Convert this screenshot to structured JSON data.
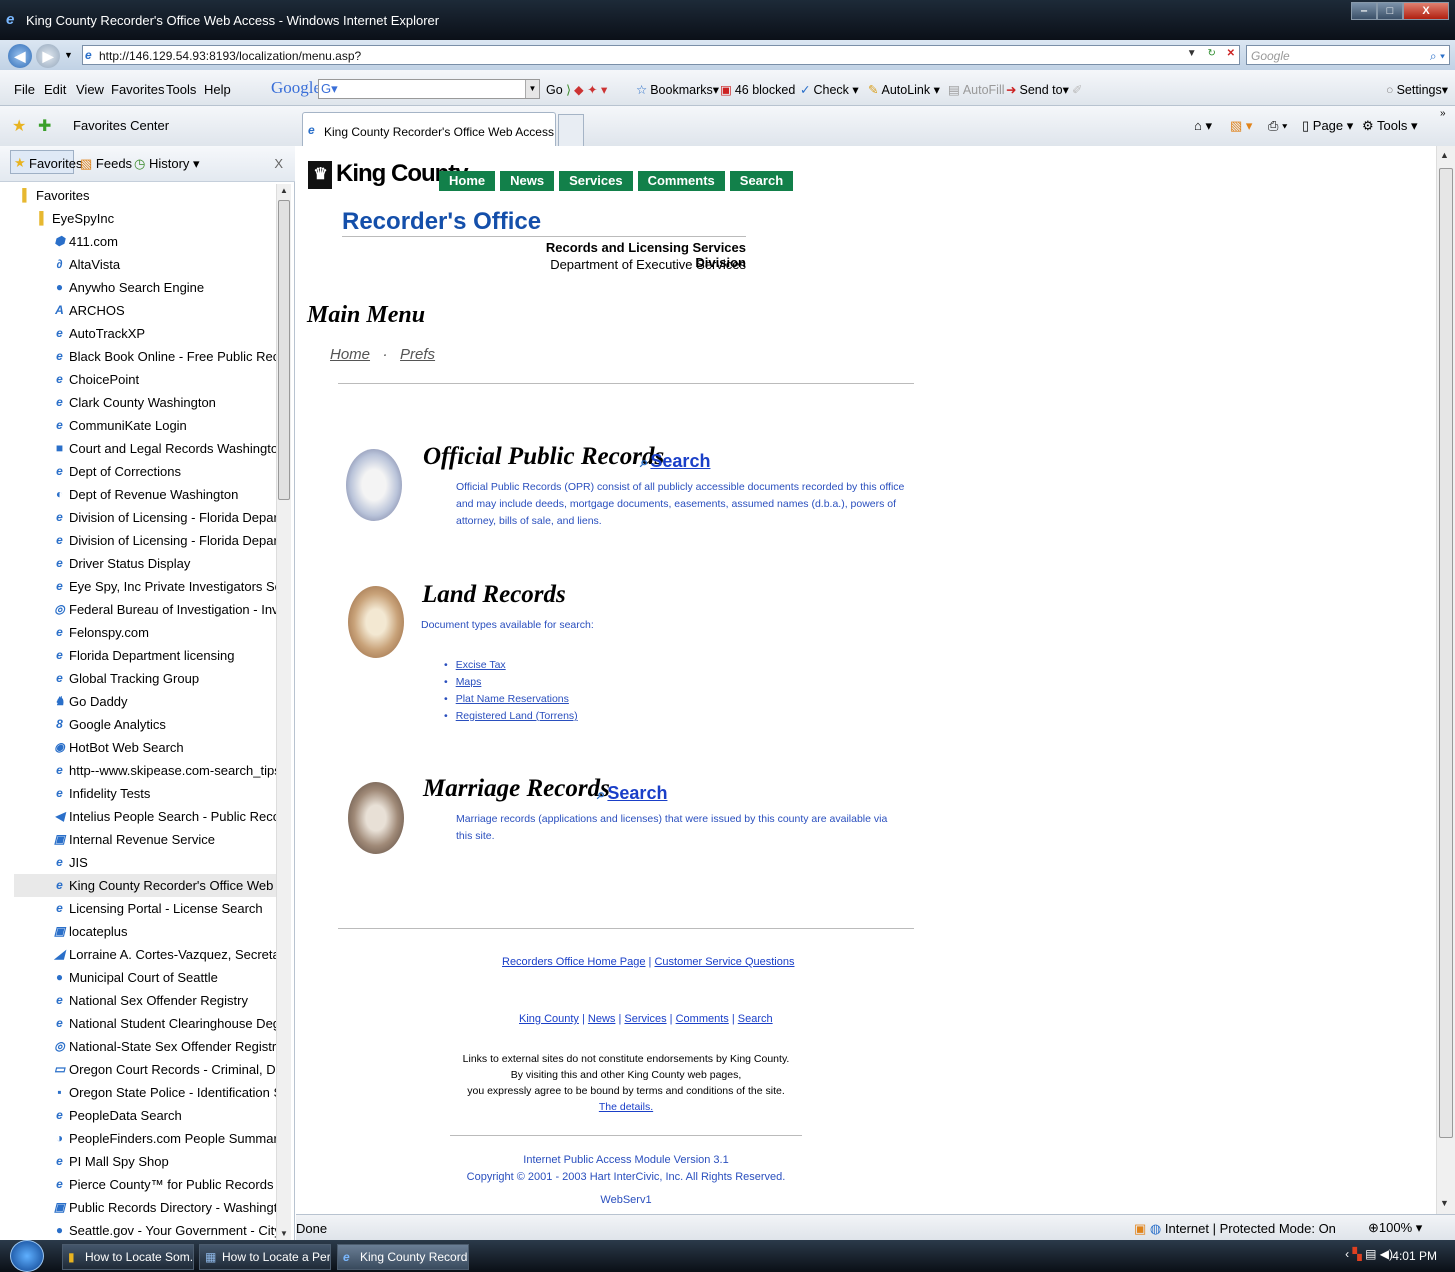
{
  "window": {
    "title": "King County Recorder's Office Web Access - Windows Internet Explorer"
  },
  "address": {
    "url": "http://146.129.54.93:8193/localization/menu.asp?",
    "search_placeholder": "Google"
  },
  "menu": [
    "File",
    "Edit",
    "View",
    "Favorites",
    "Tools",
    "Help"
  ],
  "google_toolbar": {
    "logo": "Google",
    "search_value": "G▾",
    "go": "Go",
    "bookmarks": "Bookmarks▾",
    "blocked": "46 blocked",
    "check": "Check ▾",
    "autolink": "AutoLink ▾",
    "autofill": "AutoFill",
    "sendto": "Send to▾",
    "settings": "Settings▾"
  },
  "favbar": {
    "favorites_center": "Favorites Center"
  },
  "tab": {
    "label": "King County Recorder's Office Web Access"
  },
  "commandbar": {
    "page": "Page ▾",
    "tools": "Tools ▾"
  },
  "sidebar": {
    "tabs": {
      "favorites": "Favorites",
      "feeds": "Feeds",
      "history": "History  ▾"
    },
    "close": "X",
    "root": "Favorites",
    "folder": "EyeSpyInc",
    "items": [
      {
        "label": "411.com",
        "icon": "⬢"
      },
      {
        "label": "AltaVista",
        "icon": "∂"
      },
      {
        "label": "Anywho Search Engine",
        "icon": "●"
      },
      {
        "label": "ARCHOS",
        "icon": "A"
      },
      {
        "label": "AutoTrackXP",
        "icon": "e"
      },
      {
        "label": "Black Book Online - Free Public Record Sea...",
        "icon": "e"
      },
      {
        "label": "ChoicePoint",
        "icon": "e"
      },
      {
        "label": "Clark County Washington",
        "icon": "e"
      },
      {
        "label": "CommuniKate Login",
        "icon": "e"
      },
      {
        "label": "Court and Legal Records Washington",
        "icon": "■"
      },
      {
        "label": "Dept of Corrections",
        "icon": "e"
      },
      {
        "label": "Dept of Revenue Washington",
        "icon": "◐"
      },
      {
        "label": "Division of Licensing - Florida Department ...",
        "icon": "e"
      },
      {
        "label": "Division of Licensing - Florida Department ...",
        "icon": "e"
      },
      {
        "label": "Driver Status Display",
        "icon": "e"
      },
      {
        "label": "Eye Spy, Inc Private Investigators Seattle",
        "icon": "e"
      },
      {
        "label": "Federal Bureau of Investigation - Investigat...",
        "icon": "◎"
      },
      {
        "label": "Felonspy.com",
        "icon": "e"
      },
      {
        "label": "Florida Department licensing",
        "icon": "e"
      },
      {
        "label": "Global Tracking Group",
        "icon": "e"
      },
      {
        "label": "Go Daddy",
        "icon": "♞"
      },
      {
        "label": "Google Analytics",
        "icon": "8"
      },
      {
        "label": "HotBot Web Search",
        "icon": "◉"
      },
      {
        "label": "http--www.skipease.com-search_tips-free_...",
        "icon": "e"
      },
      {
        "label": "Infidelity Tests",
        "icon": "e"
      },
      {
        "label": "Intelius People Search - Public Records, Ba...",
        "icon": "◀"
      },
      {
        "label": "Internal Revenue Service",
        "icon": "▣"
      },
      {
        "label": "JIS",
        "icon": "e"
      },
      {
        "label": "King County Recorder's Office Web Access",
        "icon": "e",
        "selected": true
      },
      {
        "label": "Licensing Portal - License Search",
        "icon": "e"
      },
      {
        "label": "locateplus",
        "icon": "▣"
      },
      {
        "label": "Lorraine A. Cortes-Vazquez, Secretary of St...",
        "icon": "◢"
      },
      {
        "label": "Municipal Court of Seattle",
        "icon": "●"
      },
      {
        "label": "National Sex Offender Registry",
        "icon": "e"
      },
      {
        "label": "National Student Clearinghouse Degree Ve...",
        "icon": "e"
      },
      {
        "label": "National-State Sex Offender Registry",
        "icon": "◎"
      },
      {
        "label": "Oregon Court Records - Criminal, Divorce, ...",
        "icon": "▭"
      },
      {
        "label": "Oregon State Police - Identification Service...",
        "icon": "▪"
      },
      {
        "label": "PeopleData Search",
        "icon": "e"
      },
      {
        "label": "PeopleFinders.com  People Summary",
        "icon": "◑"
      },
      {
        "label": "PI Mall Spy Shop",
        "icon": "e"
      },
      {
        "label": "Pierce County™ for Public Records",
        "icon": "e"
      },
      {
        "label": "Public Records Directory - Washington",
        "icon": "▣"
      },
      {
        "label": "Seattle.gov - Your Government - City Servi...",
        "icon": "●"
      }
    ]
  },
  "page": {
    "logo": "King County",
    "nav": [
      "Home",
      "News",
      "Services",
      "Comments",
      "Search"
    ],
    "office_title": "Recorder's Office",
    "division": "Records and Licensing Services Division",
    "department": "Department of Executive Services",
    "main_menu": "Main Menu",
    "crumb_home": "Home",
    "crumb_sep": "·",
    "crumb_prefs": "Prefs",
    "search_label": "Search",
    "opr": {
      "title": "Official Public Records",
      "desc_1": "Official Public Records (OPR) consist of all publicly accessible documents recorded by this office",
      "desc_2": "and may include deeds, mortgage documents, easements, assumed names (d.b.a.), powers of",
      "desc_3": "attorney, bills of sale, and liens."
    },
    "land": {
      "title": "Land Records",
      "desc": "Document types available for search:",
      "links": [
        "Excise Tax",
        "Maps",
        "Plat Name Reservations",
        "Registered Land (Torrens)"
      ]
    },
    "marriage": {
      "title": "Marriage Records",
      "desc_1": "Marriage records (applications and licenses) that were issued by this county are available via",
      "desc_2": "this site."
    },
    "footer": {
      "link_home_page": "Recorders Office Home Page",
      "link_customer": "Customer Service Questions",
      "sep": "|",
      "bottom_links": [
        "King County",
        "News",
        "Services",
        "Comments",
        "Search"
      ],
      "disclaimer_1": "Links to external sites do not constitute endorsements by King County.",
      "disclaimer_2": "By visiting this and other King County web pages,",
      "disclaimer_3": "you expressly agree to be bound by terms and conditions of the site.",
      "details": "The details.",
      "version": "Internet Public Access Module Version 3.1",
      "copyright": "Copyright © 2001 - 2003 Hart InterCivic, Inc. All Rights Reserved.",
      "webserv": "WebServ1"
    }
  },
  "status": {
    "text": "Done",
    "zone": "Internet | Protected Mode: On",
    "zoom": "100%  ▾"
  },
  "taskbar": {
    "buttons": [
      "How to Locate Som...",
      "How to Locate a Per...",
      "King County Record..."
    ],
    "clock": "4:01 PM"
  },
  "colors": {
    "kc_green": "#12804a",
    "link_blue": "#1a3fc8",
    "title_blue": "#144faa"
  }
}
